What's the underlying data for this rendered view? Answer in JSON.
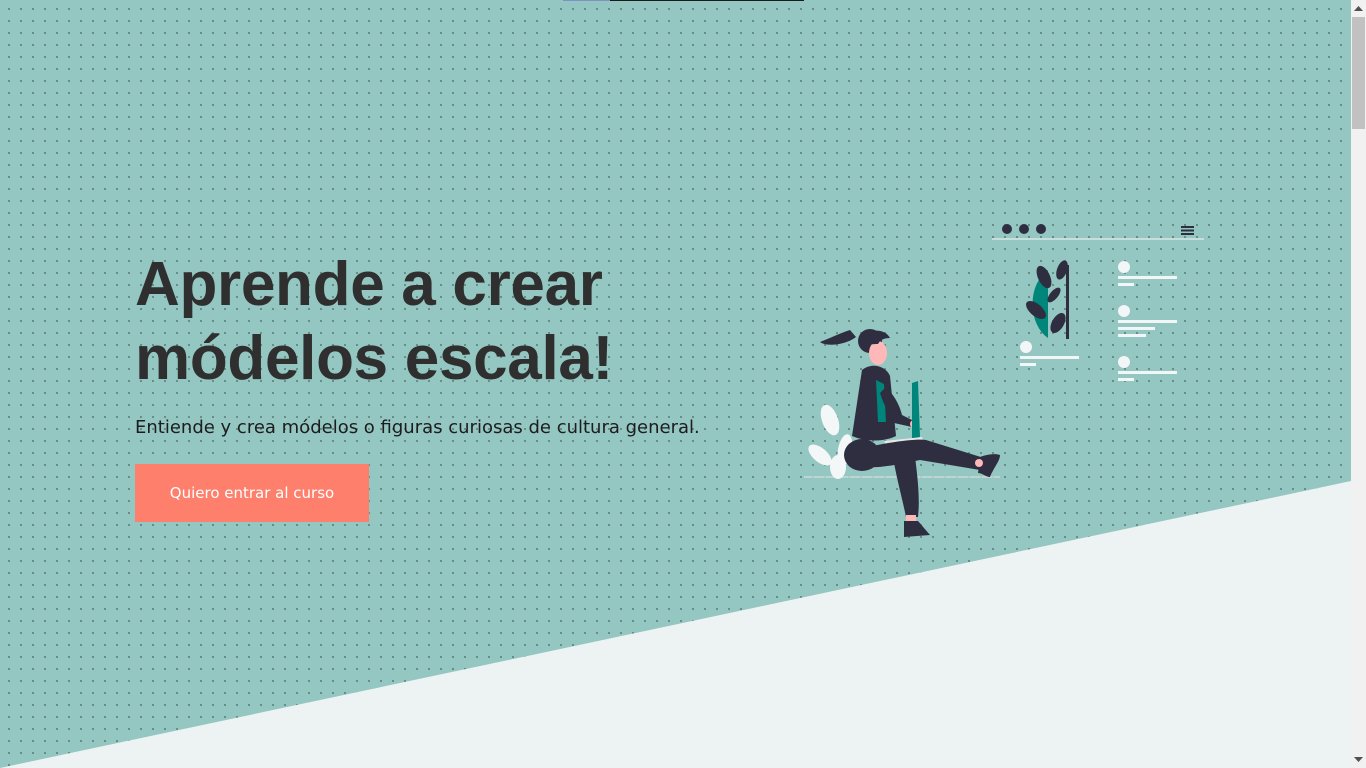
{
  "hero": {
    "headline": "Aprende a crear módelos escala!",
    "subtitle": "Entiende y crea módelos o figuras curiosas de cultura general.",
    "cta_label": "Quiero entrar al curso"
  },
  "colors": {
    "background": "#94c6c2",
    "dots": "#5c7f7b",
    "lower_panel": "#ecf3f2",
    "heading": "#2f2f2f",
    "cta": "#fd7f6c",
    "cta_text": "#ffffff",
    "illustration_dark": "#2f2e41",
    "illustration_accent": "#00857a"
  },
  "illustration": {
    "icon": "woman-working-on-laptop-illustration",
    "mockup_icons": [
      "window-dots-icon",
      "hamburger-menu-icon",
      "plant-image-icon"
    ]
  }
}
